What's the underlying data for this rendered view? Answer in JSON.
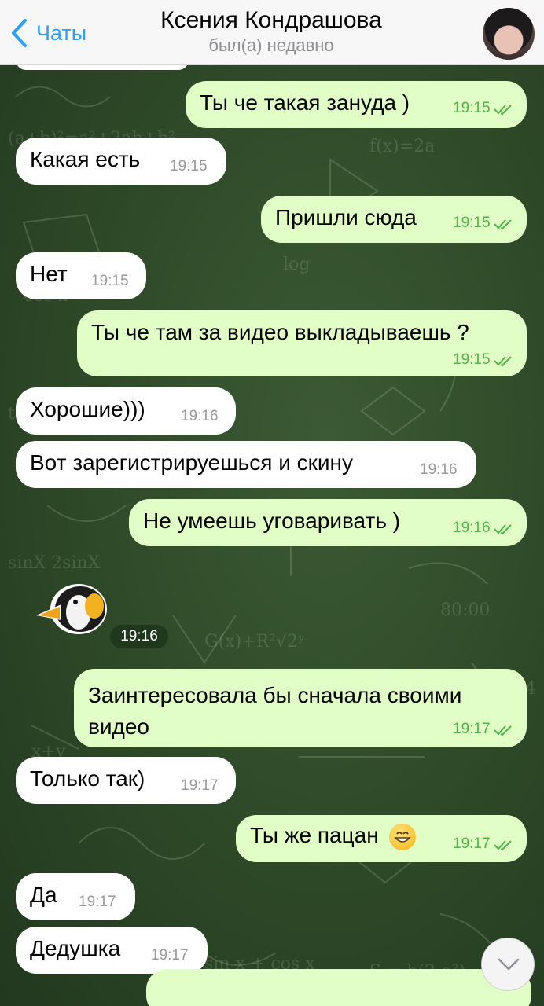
{
  "header": {
    "back_label": "Чаты",
    "title": "Ксения Кондрашова",
    "status": "был(а) недавно"
  },
  "messages": [
    {
      "dir": "out",
      "text": "Ты че такая зануда )",
      "time": "19:15"
    },
    {
      "dir": "in",
      "text": "Какая есть",
      "time": "19:15"
    },
    {
      "dir": "out",
      "text": "Пришли сюда",
      "time": "19:15"
    },
    {
      "dir": "in",
      "text": "Нет",
      "time": "19:15"
    },
    {
      "dir": "out",
      "text": "Ты че там за видео выкладываешь ?",
      "time": "19:15"
    },
    {
      "dir": "in",
      "text": "Хорошие)))",
      "time": "19:16"
    },
    {
      "dir": "in",
      "text": "Вот зарегистрируешься и скину",
      "time": "19:16"
    },
    {
      "dir": "out",
      "text": "Не умеешь уговаривать )",
      "time": "19:16"
    },
    {
      "dir": "in",
      "type": "sticker",
      "sticker": "penguin-sticker",
      "time": "19:16"
    },
    {
      "dir": "out",
      "text": "Заинтересовала бы сначала своими видео",
      "time": "19:17"
    },
    {
      "dir": "in",
      "text": "Только так)",
      "time": "19:17"
    },
    {
      "dir": "out",
      "text": "Ты же пацан",
      "emoji": "grinning-face-emoji",
      "time": "19:17"
    },
    {
      "dir": "in",
      "text": "Да",
      "time": "19:17"
    },
    {
      "dir": "in",
      "text": "Дедушка",
      "time": "19:17"
    }
  ],
  "colors": {
    "accent": "#2aa0ff",
    "outgoing_bubble": "#e1fec6",
    "incoming_bubble": "#ffffff",
    "outgoing_time": "#4fb646",
    "background": "#2d4827"
  },
  "icons": [
    "chevron-left-icon",
    "double-check-icon",
    "chevron-down-icon"
  ]
}
